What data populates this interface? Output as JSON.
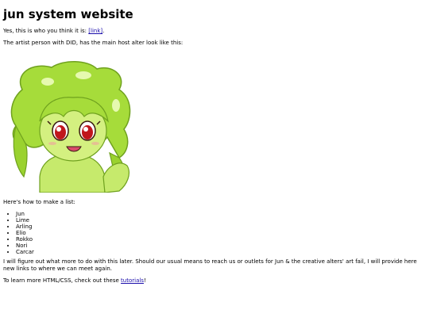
{
  "page": {
    "title": "jun system website",
    "intro_text": "Yes, this is who you think it is: ",
    "intro_link": "[link]",
    "intro_end": ".",
    "artist_text": "The artist person with DID, has the main host alter look like this:",
    "list_intro": "Here's how to make a list:",
    "list_items": [
      "Jun",
      "Lime",
      "Arling",
      "Elio",
      "Rokko",
      "Nori",
      "Carcar"
    ],
    "later_text": "I will figure out what more to do with this later. Should our usual means to reach us or outlets for Jun & the creative alters' art fail, I will provide here new links to where we can meet again.",
    "tutorials_text": "To learn more HTML/CSS, check out these ",
    "tutorials_link": "tutorials",
    "tutorials_end": "!"
  },
  "colors": {
    "link": "#1a0dab",
    "character_green": "#a6dc3a",
    "character_eye": "#c0161c"
  }
}
